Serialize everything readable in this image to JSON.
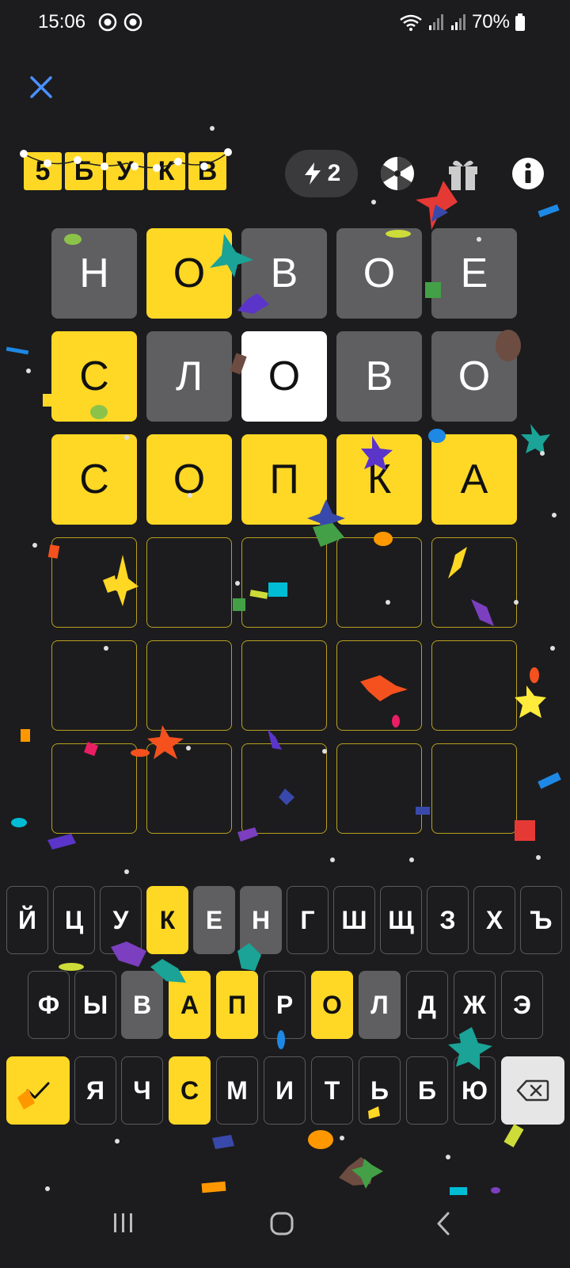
{
  "status": {
    "time": "15:06",
    "battery": "70%"
  },
  "header": {
    "logo_letters": [
      "5",
      "Б",
      "У",
      "К",
      "В"
    ],
    "hint_count": "2",
    "icons": [
      "close-icon",
      "lightning-icon",
      "wheel-icon",
      "gift-icon",
      "info-icon"
    ]
  },
  "board": {
    "rows": [
      [
        {
          "letter": "Н",
          "state": "gray"
        },
        {
          "letter": "О",
          "state": "yellow"
        },
        {
          "letter": "В",
          "state": "gray"
        },
        {
          "letter": "О",
          "state": "gray"
        },
        {
          "letter": "Е",
          "state": "gray"
        }
      ],
      [
        {
          "letter": "С",
          "state": "yellow"
        },
        {
          "letter": "Л",
          "state": "gray"
        },
        {
          "letter": "О",
          "state": "white"
        },
        {
          "letter": "В",
          "state": "gray"
        },
        {
          "letter": "О",
          "state": "gray"
        }
      ],
      [
        {
          "letter": "С",
          "state": "yellow"
        },
        {
          "letter": "О",
          "state": "yellow"
        },
        {
          "letter": "П",
          "state": "yellow"
        },
        {
          "letter": "К",
          "state": "yellow"
        },
        {
          "letter": "А",
          "state": "yellow"
        }
      ],
      [
        {
          "letter": "",
          "state": "empty"
        },
        {
          "letter": "",
          "state": "empty"
        },
        {
          "letter": "",
          "state": "empty"
        },
        {
          "letter": "",
          "state": "empty"
        },
        {
          "letter": "",
          "state": "empty"
        }
      ],
      [
        {
          "letter": "",
          "state": "empty"
        },
        {
          "letter": "",
          "state": "empty"
        },
        {
          "letter": "",
          "state": "empty"
        },
        {
          "letter": "",
          "state": "empty"
        },
        {
          "letter": "",
          "state": "empty"
        }
      ],
      [
        {
          "letter": "",
          "state": "empty"
        },
        {
          "letter": "",
          "state": "empty"
        },
        {
          "letter": "",
          "state": "empty"
        },
        {
          "letter": "",
          "state": "empty"
        },
        {
          "letter": "",
          "state": "empty"
        }
      ]
    ]
  },
  "keyboard": {
    "row1": [
      {
        "label": "Й",
        "state": "default"
      },
      {
        "label": "Ц",
        "state": "default"
      },
      {
        "label": "У",
        "state": "default"
      },
      {
        "label": "К",
        "state": "yellow"
      },
      {
        "label": "Е",
        "state": "gray"
      },
      {
        "label": "Н",
        "state": "gray"
      },
      {
        "label": "Г",
        "state": "default"
      },
      {
        "label": "Ш",
        "state": "default"
      },
      {
        "label": "Щ",
        "state": "default"
      },
      {
        "label": "З",
        "state": "default"
      },
      {
        "label": "Х",
        "state": "default"
      },
      {
        "label": "Ъ",
        "state": "default"
      }
    ],
    "row2": [
      {
        "label": "Ф",
        "state": "default"
      },
      {
        "label": "Ы",
        "state": "default"
      },
      {
        "label": "В",
        "state": "gray"
      },
      {
        "label": "А",
        "state": "yellow"
      },
      {
        "label": "П",
        "state": "yellow"
      },
      {
        "label": "Р",
        "state": "default"
      },
      {
        "label": "О",
        "state": "yellow"
      },
      {
        "label": "Л",
        "state": "gray"
      },
      {
        "label": "Д",
        "state": "default"
      },
      {
        "label": "Ж",
        "state": "default"
      },
      {
        "label": "Э",
        "state": "default"
      }
    ],
    "row3": [
      {
        "label": "Я",
        "state": "default"
      },
      {
        "label": "Ч",
        "state": "default"
      },
      {
        "label": "С",
        "state": "yellow"
      },
      {
        "label": "М",
        "state": "default"
      },
      {
        "label": "И",
        "state": "default"
      },
      {
        "label": "Т",
        "state": "default"
      },
      {
        "label": "Ь",
        "state": "default"
      },
      {
        "label": "Б",
        "state": "default"
      },
      {
        "label": "Ю",
        "state": "default"
      }
    ],
    "enter_icon": "checkmark-icon",
    "backspace_icon": "backspace-icon"
  },
  "colors": {
    "background": "#1c1c1e",
    "correct": "#ffd825",
    "absent": "#5f5f61",
    "current": "#ffffff"
  }
}
